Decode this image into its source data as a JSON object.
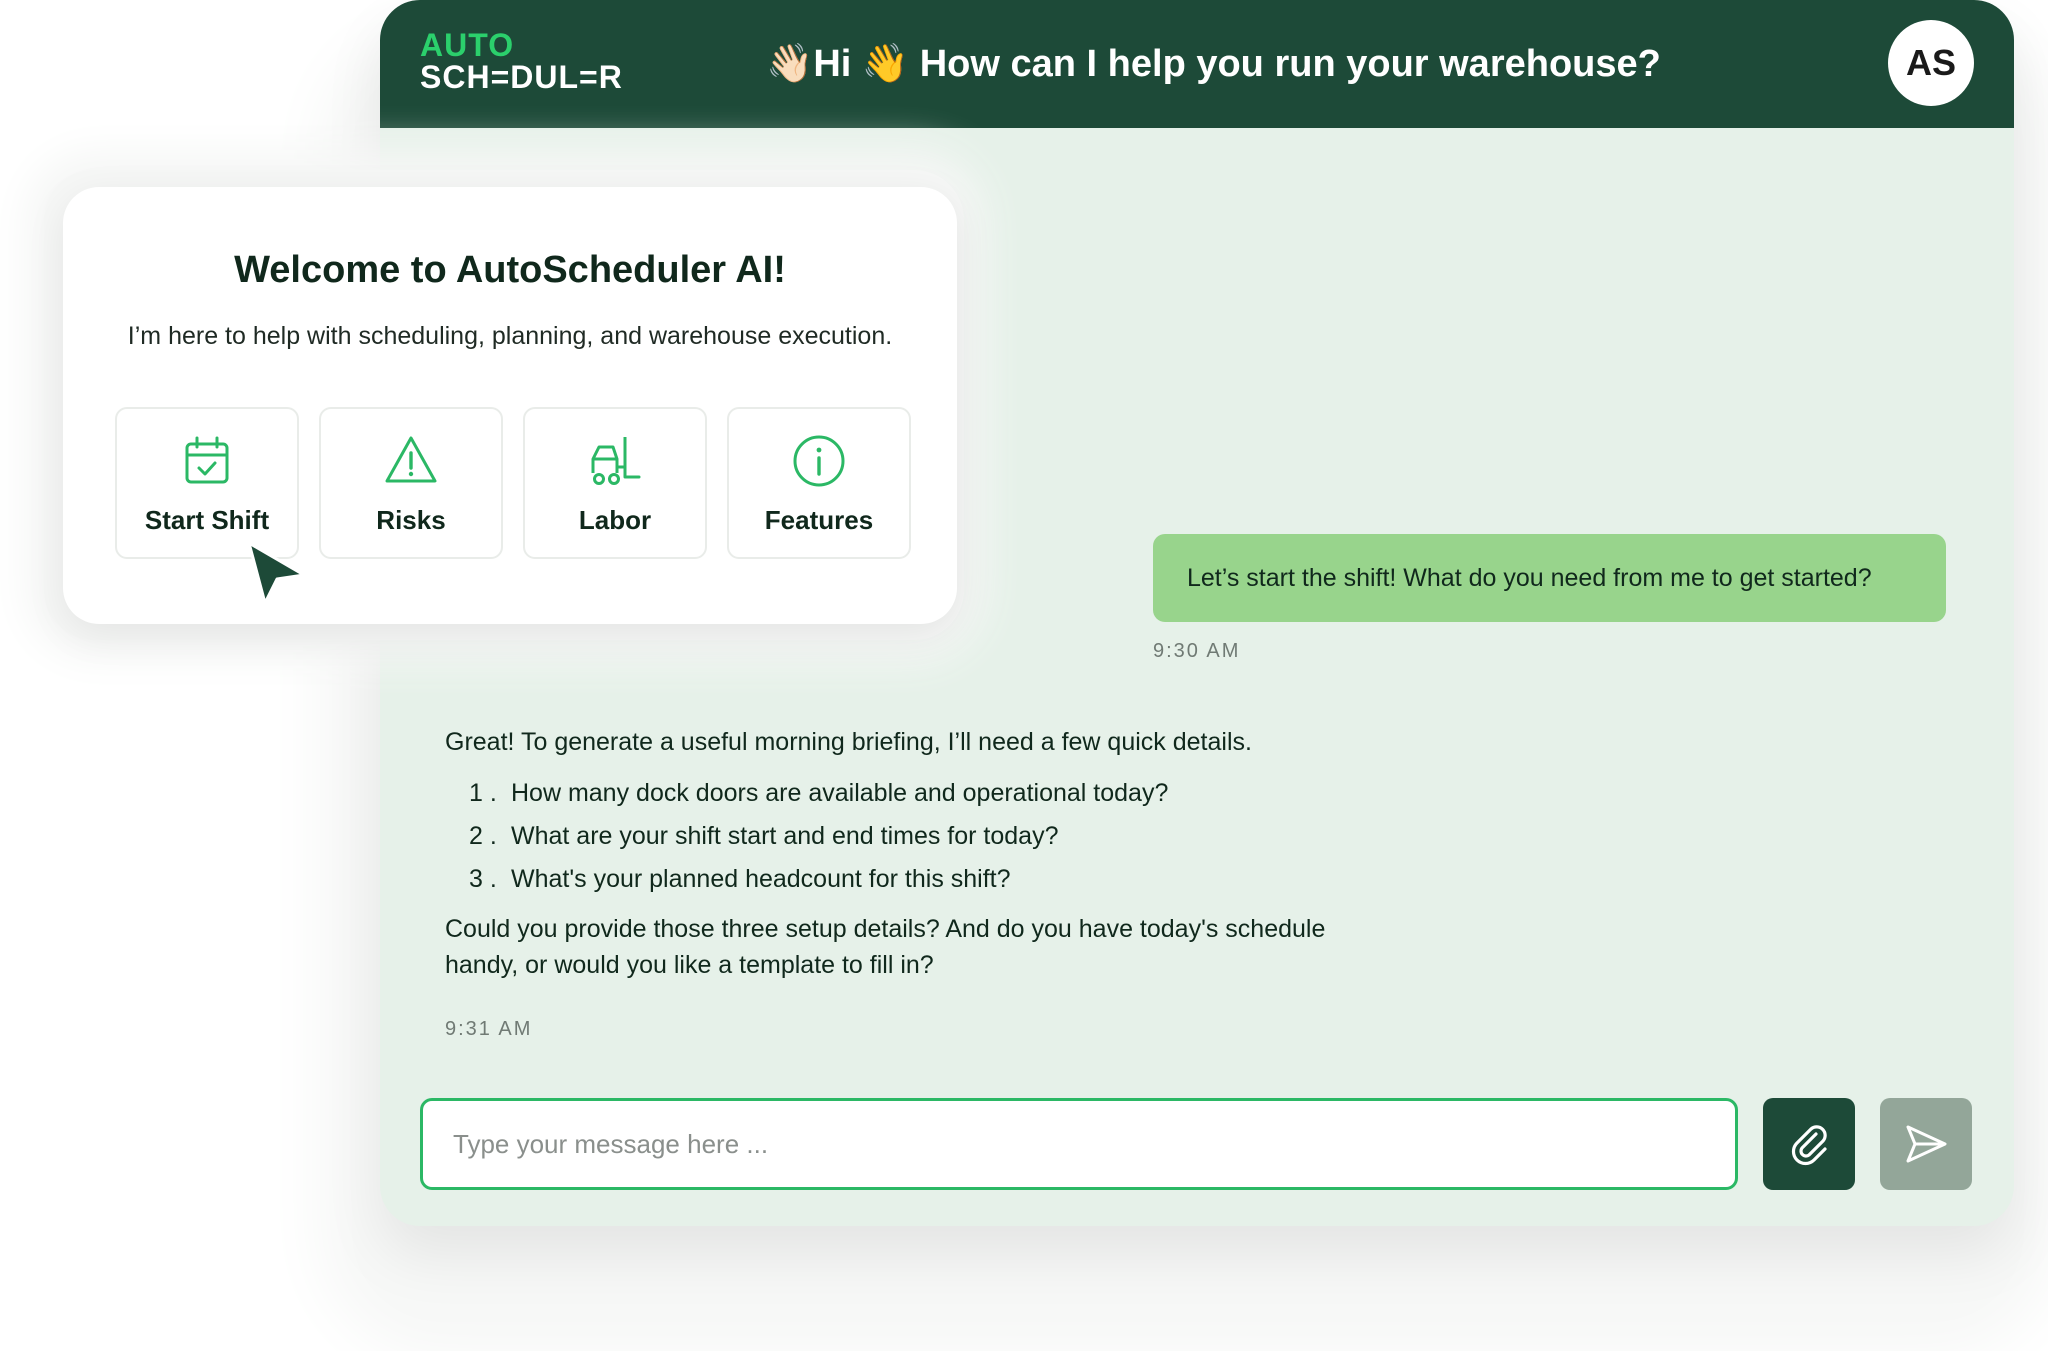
{
  "app": {
    "logo_line1": "AUTO",
    "logo_line2": "SCH=DUL=R",
    "greeting": "👋🏻Hi 👋 How can I help you run your warehouse?",
    "avatar_initials": "AS"
  },
  "welcome": {
    "title": "Welcome to AutoScheduler AI!",
    "subtitle": "I’m here to help with scheduling, planning, and warehouse execution.",
    "actions": [
      {
        "label": "Start Shift",
        "icon": "calendar-check-icon"
      },
      {
        "label": "Risks",
        "icon": "warning-triangle-icon"
      },
      {
        "label": "Labor",
        "icon": "forklift-icon"
      },
      {
        "label": "Features",
        "icon": "info-circle-icon"
      }
    ]
  },
  "chat": {
    "user_message": "Let’s start the shift! What do you need from me to get started?",
    "user_time": "9:30 AM",
    "bot_intro": "Great! To generate a useful morning briefing, I’ll need a few quick details.",
    "bot_list": [
      {
        "num": "1 .",
        "text": "How many dock doors are available and operational today?"
      },
      {
        "num": "2 .",
        "text": "What are your shift start and end times for today?"
      },
      {
        "num": "3 .",
        "text": "What's your planned headcount for this shift?"
      }
    ],
    "bot_outro": "Could you provide those three setup details? And do you have today's schedule handy, or would you like a template to fill in?",
    "bot_time": "9:31 AM"
  },
  "input": {
    "placeholder": "Type your message here ..."
  },
  "colors": {
    "header": "#1d4a38",
    "accent": "#2bb865",
    "chat_background": "#e6f1e9",
    "user_bubble": "#98d48c",
    "send_button_disabled": "#93a699"
  }
}
